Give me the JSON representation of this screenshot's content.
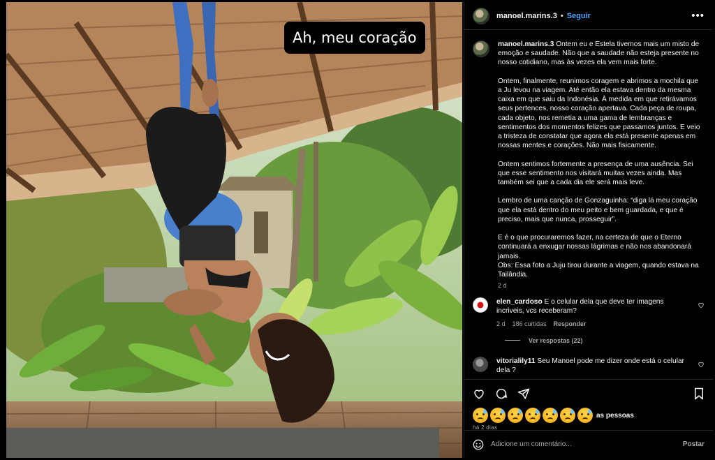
{
  "photo": {
    "sticker_text": "Ah, meu coração"
  },
  "header": {
    "username": "manoel.marins.3",
    "separator": "•",
    "follow_label": "Seguir",
    "more_label": "•••"
  },
  "post": {
    "username": "manoel.marins.3",
    "caption": "Ontem eu e Estela tivemos mais um misto de emoção e saudade. Não que a saudade não esteja presente no nosso cotidiano, mas às vezes ela vem mais forte.\n\nOntem, finalmente, reunimos coragem e abrimos a mochila que a Ju levou na viagem. Até então ela estava dentro da mesma caixa em que saiu da Indonésia. À medida em que retirávamos seus pertences, nosso coração apertava. Cada peça de roupa, cada objeto, nos remetia a uma gama de lembranças e sentimentos dos momentos felizes que passamos juntos. E veio a tristeza de constatar que agora ela está presente apenas em nossas mentes e corações. Não mais fisicamente.\n\nOntem sentimos fortemente a presença de uma ausência. Sei que esse sentimento nos visitará muitas vezes ainda. Mas também sei que a cada dia ele será mais leve.\n\nLembro de uma canção de Gonzaguinha: “diga lá meu coração que ela está dentro do meu peito e bem guardada, e que é preciso, mais que nunca, prosseguir”.\n\nE é o que procuraremos fazer, na certeza de que o Eterno continuará a enxugar nossas lágrimas e não nos abandonará jamais.\nObs: Essa foto a Juju tirou durante a viagem, quando estava na Tailândia.",
    "time": "2 d"
  },
  "comments": [
    {
      "username": "elen_cardoso",
      "text": "E o celular dela que deve ter imagens incriveis, vcs receberam?",
      "time": "2 d",
      "likes": "186 curtidas",
      "reply_label": "Responder",
      "view_replies": "Ver respostas (22)"
    },
    {
      "username": "vitorialily11",
      "text": "Seu Manoel pode me dizer onde está o celular dela ?"
    }
  ],
  "likes": {
    "emoji_count": 7,
    "text": "as pessoas",
    "time": "há 2 dias"
  },
  "add_comment": {
    "placeholder": "Adicione um comentário...",
    "post_label": "Postar"
  },
  "icons": [
    "heart-icon",
    "comment-icon",
    "share-icon",
    "bookmark-icon",
    "emoji-icon",
    "more-icon"
  ]
}
